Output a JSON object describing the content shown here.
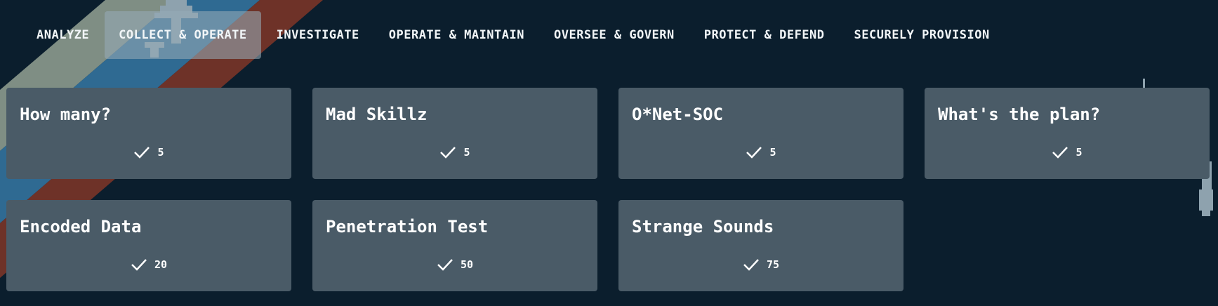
{
  "colors": {
    "background": "#0b1e2d",
    "card": "#4a5b67",
    "active_tab": "#8ea2ae",
    "stripe_gray": "#7f8e84",
    "stripe_blue": "#2f6a92",
    "stripe_red": "#6e3228",
    "text": "#ffffff"
  },
  "nav": {
    "tabs": [
      {
        "label": "ANALYZE",
        "active": false
      },
      {
        "label": "COLLECT & OPERATE",
        "active": true
      },
      {
        "label": "INVESTIGATE",
        "active": false
      },
      {
        "label": "OPERATE & MAINTAIN",
        "active": false
      },
      {
        "label": "OVERSEE & GOVERN",
        "active": false
      },
      {
        "label": "PROTECT & DEFEND",
        "active": false
      },
      {
        "label": "SECURELY PROVISION",
        "active": false
      }
    ]
  },
  "challenges": [
    {
      "title": "How many?",
      "solves": "5",
      "icon": "check-icon"
    },
    {
      "title": "Mad Skillz",
      "solves": "5",
      "icon": "check-icon"
    },
    {
      "title": "O*Net-SOC",
      "solves": "5",
      "icon": "check-icon"
    },
    {
      "title": "What's the plan?",
      "solves": "5",
      "icon": "check-icon"
    },
    {
      "title": "Encoded Data",
      "solves": "20",
      "icon": "check-icon"
    },
    {
      "title": "Penetration Test",
      "solves": "50",
      "icon": "check-icon"
    },
    {
      "title": "Strange Sounds",
      "solves": "75",
      "icon": "check-icon"
    }
  ]
}
